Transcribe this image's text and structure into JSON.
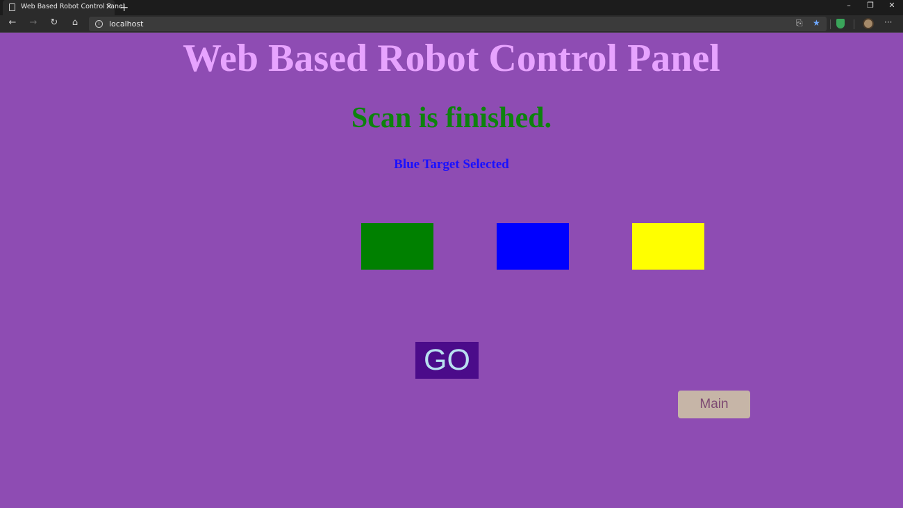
{
  "browser": {
    "tab_title": "Web Based Robot Control Panel",
    "tab_close": "✕",
    "new_tab": "+",
    "url": "localhost",
    "window_controls": {
      "minimize": "–",
      "restore": "❐",
      "close": "✕"
    },
    "nav": {
      "back": "←",
      "forward": "→",
      "reload": "↻",
      "home": "⌂"
    },
    "toolbar_icons": {
      "read_aloud": "⎘",
      "favorite": "★",
      "more": "···"
    }
  },
  "page": {
    "title": "Web Based Robot Control Panel",
    "status": "Scan is finished.",
    "selection": "Blue Target Selected",
    "targets": [
      {
        "name": "green",
        "color": "#008000"
      },
      {
        "name": "blue",
        "color": "#0000ff"
      },
      {
        "name": "yellow",
        "color": "#ffff00"
      }
    ],
    "go_label": "GO",
    "main_label": "Main"
  },
  "colors": {
    "background": "#8e4cb3",
    "title": "#e7a3ff",
    "status": "#0d820d",
    "selection": "#1a10ff",
    "go_bg": "#4b0b8a",
    "go_text": "#b9e0f0",
    "main_bg": "#c6b5a7",
    "main_text": "#7d4a72"
  }
}
